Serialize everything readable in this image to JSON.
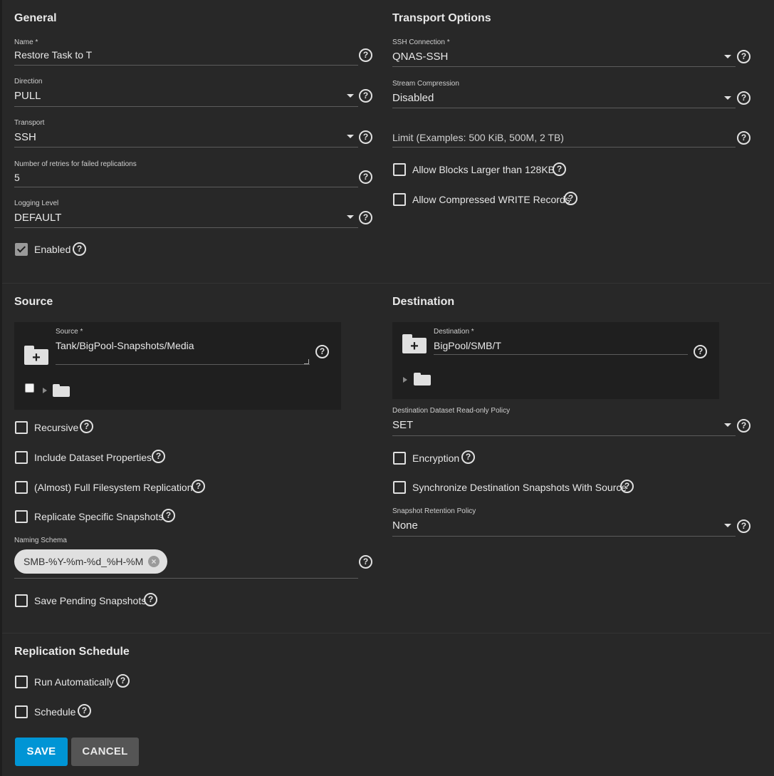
{
  "general": {
    "title": "General",
    "name_label": "Name *",
    "name_value": "Restore Task to T",
    "direction_label": "Direction",
    "direction_value": "PULL",
    "transport_label": "Transport",
    "transport_value": "SSH",
    "retries_label": "Number of retries for failed replications",
    "retries_value": "5",
    "logging_label": "Logging Level",
    "logging_value": "DEFAULT",
    "enabled_label": "Enabled",
    "enabled_checked": true
  },
  "transport_options": {
    "title": "Transport Options",
    "ssh_label": "SSH Connection *",
    "ssh_value": "QNAS-SSH",
    "compression_label": "Stream Compression",
    "compression_value": "Disabled",
    "limit_placeholder": "Limit (Examples: 500 KiB, 500M, 2 TB)",
    "large_blocks_label": "Allow Blocks Larger than 128KB",
    "compressed_write_label": "Allow Compressed WRITE Records"
  },
  "source": {
    "title": "Source",
    "source_label": "Source *",
    "source_value": "Tank/BigPool-Snapshots/Media",
    "recursive_label": "Recursive",
    "dataset_props_label": "Include Dataset Properties",
    "full_fs_label": "(Almost) Full Filesystem Replication",
    "specific_snapshots_label": "Replicate Specific Snapshots",
    "naming_schema_label": "Naming Schema",
    "naming_schema_chip": "SMB-%Y-%m-%d_%H-%M",
    "save_pending_label": "Save Pending Snapshots"
  },
  "destination": {
    "title": "Destination",
    "destination_label": "Destination *",
    "destination_value": "BigPool/SMB/T",
    "readonly_label": "Destination Dataset Read-only Policy",
    "readonly_value": "SET",
    "encryption_label": "Encryption",
    "sync_label": "Synchronize Destination Snapshots With Source",
    "retention_label": "Snapshot Retention Policy",
    "retention_value": "None"
  },
  "schedule": {
    "title": "Replication Schedule",
    "run_auto_label": "Run Automatically",
    "schedule_label": "Schedule"
  },
  "actions": {
    "save_label": "SAVE",
    "cancel_label": "CANCEL"
  },
  "colors": {
    "background": "#282828",
    "primary_button": "#0095d5",
    "secondary_button": "#555555"
  },
  "icons": {
    "help": "help-circle-icon",
    "dropdown": "chevron-down-icon",
    "folder_add": "folder-plus-icon",
    "folder": "folder-icon",
    "chip_remove": "close-circle-icon"
  }
}
